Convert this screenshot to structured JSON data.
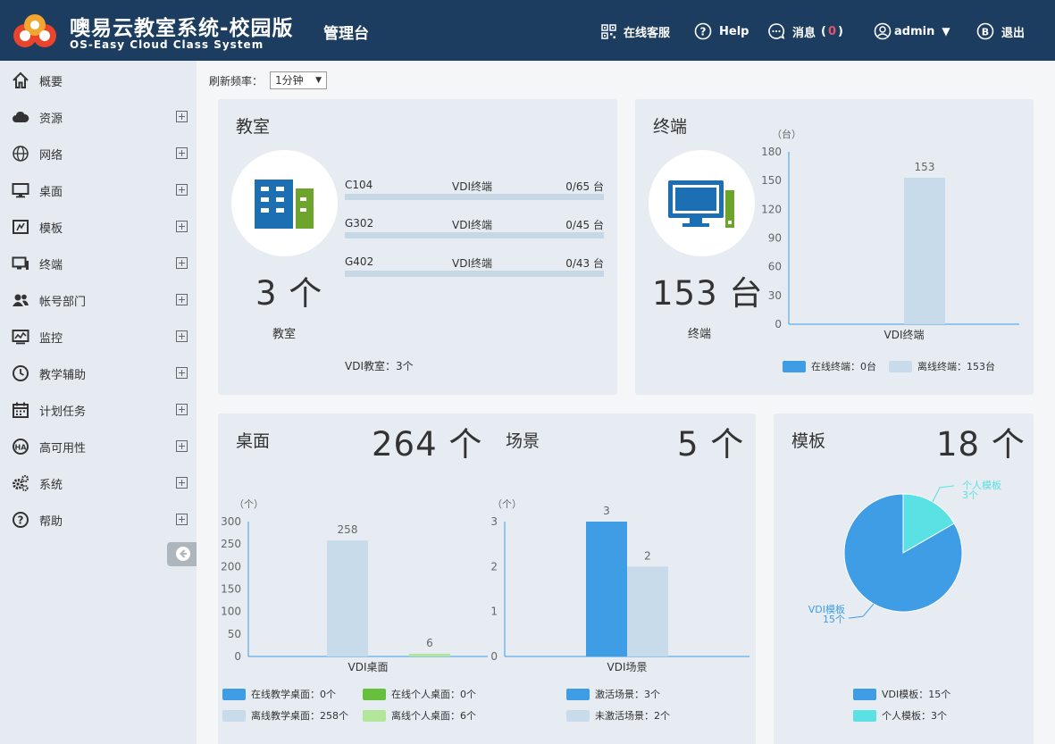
{
  "header": {
    "title": "噢易云教室系统-校园版",
    "subtitle": "OS-Easy Cloud Class System",
    "mgmt": "管理台",
    "service": "在线客服",
    "help": "Help",
    "messages": "消息",
    "msg_count": "0",
    "user": "admin",
    "logout": "退出"
  },
  "sidebar": {
    "items": [
      {
        "label": "概要",
        "icon": "home-icon"
      },
      {
        "label": "资源",
        "icon": "cloud-icon"
      },
      {
        "label": "网络",
        "icon": "globe-icon"
      },
      {
        "label": "桌面",
        "icon": "monitor-icon"
      },
      {
        "label": "模板",
        "icon": "template-icon"
      },
      {
        "label": "终端",
        "icon": "terminal-icon"
      },
      {
        "label": "帐号部门",
        "icon": "users-icon"
      },
      {
        "label": "监控",
        "icon": "monitor-chart-icon"
      },
      {
        "label": "教学辅助",
        "icon": "clock-icon"
      },
      {
        "label": "计划任务",
        "icon": "calendar-icon"
      },
      {
        "label": "高可用性",
        "icon": "ha-icon"
      },
      {
        "label": "系统",
        "icon": "gears-icon"
      },
      {
        "label": "帮助",
        "icon": "help-icon"
      }
    ]
  },
  "refresh": {
    "label": "刷新频率：",
    "value": "1分钟"
  },
  "classroom": {
    "title": "教室",
    "count": "3 个",
    "label": "教室",
    "footer": "VDI教室：3个",
    "rooms": [
      {
        "name": "C104",
        "type": "VDI终端",
        "count": "0/65 台"
      },
      {
        "name": "G302",
        "type": "VDI终端",
        "count": "0/45 台"
      },
      {
        "name": "G402",
        "type": "VDI终端",
        "count": "0/43 台"
      }
    ]
  },
  "terminal": {
    "title": "终端",
    "count": "153 台",
    "label": "终端",
    "chart_data": {
      "type": "bar",
      "ylabel": "（台）",
      "categories": [
        "VDI终端"
      ],
      "series": [
        {
          "name": "在线终端：0台",
          "values": [
            0
          ],
          "color": "#3f9de6"
        },
        {
          "name": "离线终端：153台",
          "values": [
            153
          ],
          "color": "#c8dbeb"
        }
      ],
      "yticks": [
        0,
        30,
        60,
        90,
        120,
        150,
        180
      ],
      "ylim": [
        0,
        180
      ],
      "data_labels": [
        "",
        "153"
      ]
    }
  },
  "desktop": {
    "title": "桌面",
    "count": "264 个",
    "chart_data": {
      "type": "bar",
      "ylabel": "（个）",
      "categories": [
        "VDI桌面"
      ],
      "series": [
        {
          "name": "在线教学桌面：0个",
          "values": [
            0
          ],
          "color": "#3f9de6"
        },
        {
          "name": "离线教学桌面：258个",
          "values": [
            258
          ],
          "color": "#c8dbeb"
        },
        {
          "name": "在线个人桌面：0个",
          "values": [
            0
          ],
          "color": "#67bf3e"
        },
        {
          "name": "离线个人桌面：6个",
          "values": [
            6
          ],
          "color": "#b2e69a"
        }
      ],
      "yticks": [
        0,
        50,
        100,
        150,
        200,
        250,
        300
      ],
      "ylim": [
        0,
        300
      ],
      "data_labels": [
        "258",
        "6"
      ]
    }
  },
  "scene": {
    "title": "场景",
    "count": "5 个",
    "chart_data": {
      "type": "bar",
      "ylabel": "（个）",
      "categories": [
        "VDI场景"
      ],
      "series": [
        {
          "name": "激活场景：3个",
          "values": [
            3
          ],
          "color": "#3f9de6"
        },
        {
          "name": "未激活场景：2个",
          "values": [
            2
          ],
          "color": "#c8dbeb"
        }
      ],
      "yticks": [
        0,
        1,
        2,
        3
      ],
      "ylim": [
        0,
        3
      ],
      "data_labels": [
        "3",
        "2"
      ]
    }
  },
  "template": {
    "title": "模板",
    "count": "18 个",
    "chart_data": {
      "type": "pie",
      "slices": [
        {
          "name": "VDI模板",
          "value": 15,
          "color": "#3f9de6",
          "label": "VDI模板",
          "sublabel": "15个"
        },
        {
          "name": "个人模板",
          "value": 3,
          "color": "#5ae1e3",
          "label": "个人模板",
          "sublabel": "3个"
        }
      ],
      "legend": [
        "VDI模板：15个",
        "个人模板：3个"
      ]
    }
  }
}
